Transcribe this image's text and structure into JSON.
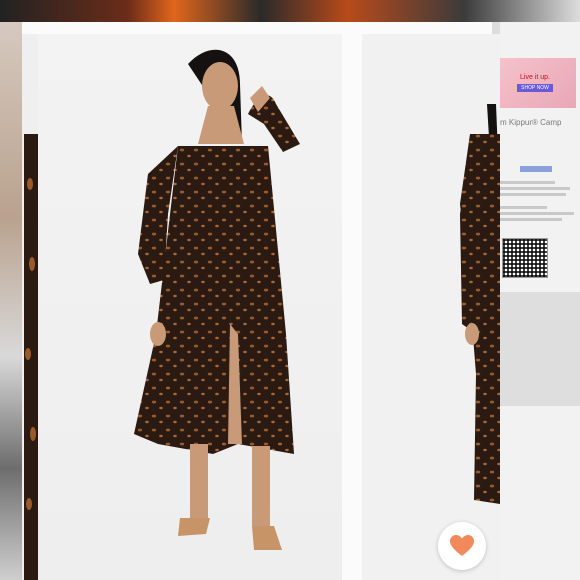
{
  "background_ad": {
    "headline": "Live it up.",
    "cta": "SHOP NOW"
  },
  "background_heading": "m Kippur® Camp",
  "favorite_button": {
    "icon": "heart-icon",
    "color": "#f08a5d"
  },
  "dress_palette": {
    "dark": "#2a1a12",
    "spot": "#9a5a2a"
  }
}
